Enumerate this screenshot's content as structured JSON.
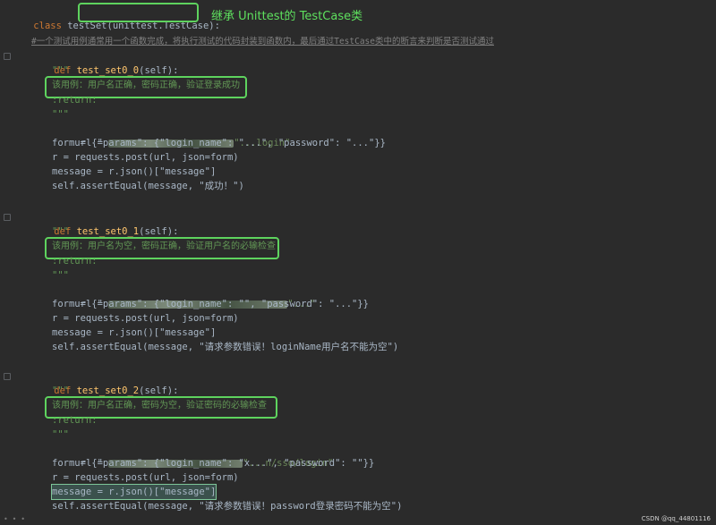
{
  "header": {
    "class_kw": "class",
    "class_name": "testSet",
    "class_paren": "(unittest.TestCase):",
    "annotation": "继承 Unittest的 TestCase类"
  },
  "comment_line": "#一个测试用例通常用一个函数完成，将执行测试的代码封装到函数内，最后通过TestCase类中的断言来判断是否测试通过",
  "methods": [
    {
      "def": "def",
      "name": "test_set0_0",
      "args": "(self):",
      "doc_open": "\"\"\"",
      "doc_text": "该用例：用户名正确，密码正确，验证登录成功",
      "doc_return": ":return:",
      "doc_close": "\"\"\"",
      "url_prefix": "url = ",
      "url_visible": "\"...login\"",
      "form_line": "form = {\"params\": {\"login_name\": \"...\", \"password\": \"...\"}}",
      "req_line": "r = requests.post(url, json=form)",
      "msg_line": "message = r.json()[\"message\"]",
      "assert_line": "self.assertEqual(message, \"成功！\")"
    },
    {
      "def": "def",
      "name": "test_set0_1",
      "args": "(self):",
      "doc_open": "\"\"\"",
      "doc_text": "该用例：用户名为空，密码正确，验证用户名的必输检查",
      "doc_return": ":return:",
      "doc_close": "\"\"\"",
      "url_prefix": "url = ",
      "url_visible": "\"...\"",
      "form_line": "form = {\"params\": {\"login_name\": \"\", \"password\": \"...\"}}",
      "req_line": "r = requests.post(url, json=form)",
      "msg_line": "message = r.json()[\"message\"]",
      "assert_line": "self.assertEqual(message, \"请求参数错误！loginName用户名不能为空\")"
    },
    {
      "def": "def",
      "name": "test_set0_2",
      "args": "(self):",
      "doc_open": "\"\"\"",
      "doc_text": "该用例：用户名正确，密码为空，验证密码的必输检查",
      "doc_return": ":return:",
      "doc_close": "\"\"\"",
      "url_prefix": "url = ",
      "url_visible": "\"...n/sso/login\"",
      "form_line": "form = {\"params\": {\"login_name\": \"x...\", \"password\": \"\"}}",
      "req_line": "r = requests.post(url, json=form)",
      "msg_line": "message = r.json()[\"message\"]",
      "assert_line": "self.assertEqual(message, \"请求参数错误！password登录密码不能为空\")"
    }
  ],
  "watermark": "CSDN @qq_44801116",
  "bottom_dots": "• • •",
  "colors": {
    "background": "#2b2b2b",
    "highlight_box": "#5ed35e",
    "keyword": "#cc7832",
    "function": "#ffc66d",
    "string": "#6a8759"
  }
}
